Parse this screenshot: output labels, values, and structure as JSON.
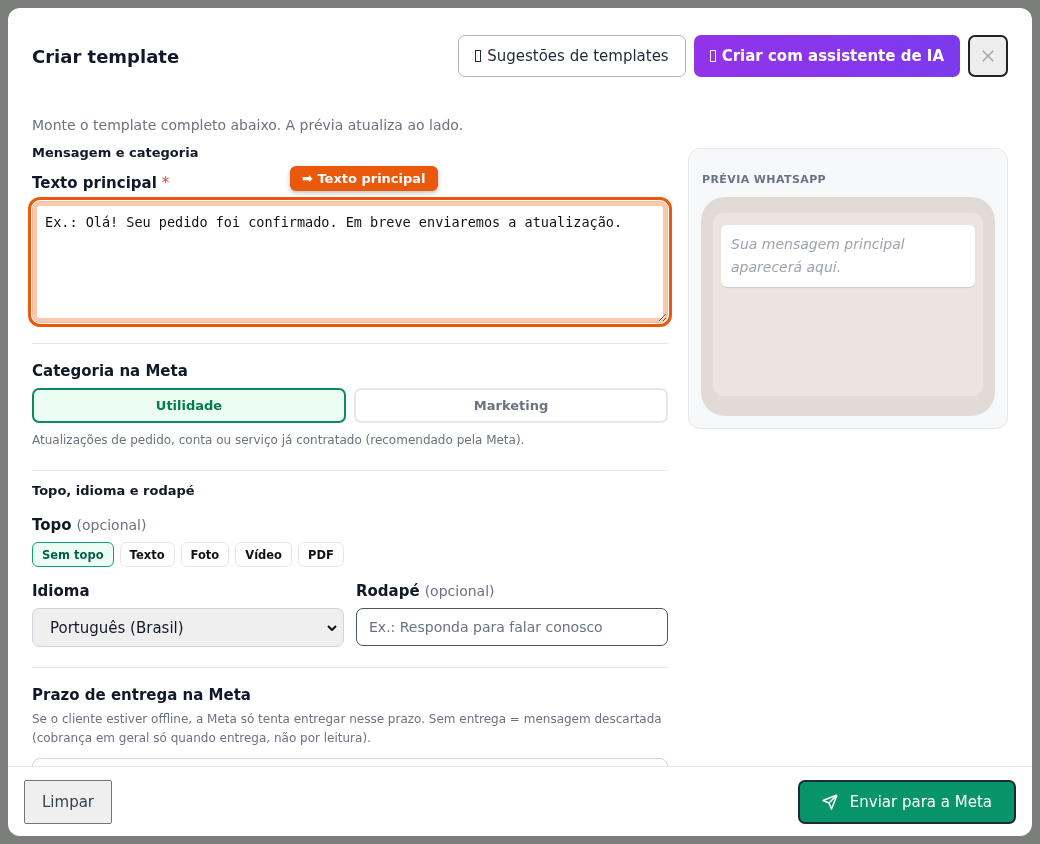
{
  "dialog": {
    "title": "Criar template",
    "actions": [
      {
        "label": "Sugestões de templates",
        "kind": "secondary"
      },
      {
        "label": "Criar com assistente de IA",
        "kind": "primary"
      }
    ]
  },
  "intro": "Monte o template completo abaixo. A prévia atualiza ao lado.",
  "message_section": {
    "heading": "Mensagem e categoria",
    "main_text": {
      "label": "Texto principal",
      "required": "*",
      "placeholder": "Ex.: Olá! Seu pedido foi confirmado. Em breve enviaremos a atualização.",
      "highlighted": true,
      "highlight_badge": "➡ Texto principal"
    },
    "category": {
      "label": "Categoria na Meta",
      "options": [
        {
          "label": "Utilidade",
          "selected": true
        },
        {
          "label": "Marketing",
          "selected": false
        }
      ],
      "hint": "Atualizações de pedido, conta ou serviço já contratado (recomendado pela Meta)."
    }
  },
  "header_section": {
    "heading": "Topo, idioma e rodapé",
    "topo": {
      "label": "Topo",
      "optional": "(opcional)",
      "options": [
        {
          "label": "Sem topo",
          "selected": true
        },
        {
          "label": "Texto",
          "selected": false
        },
        {
          "label": "Foto",
          "selected": false
        },
        {
          "label": "Vídeo",
          "selected": false
        },
        {
          "label": "PDF",
          "selected": false
        }
      ]
    },
    "language": {
      "label": "Idioma",
      "value": "Português (Brasil)"
    },
    "footer": {
      "label": "Rodapé",
      "optional": "(opcional)",
      "placeholder": "Ex.: Responda para falar conosco"
    }
  },
  "delivery_section": {
    "heading": "Prazo de entrega na Meta",
    "description": "Se o cliente estiver offline, a Meta só tenta entregar nesse prazo. Sem entrega = mensagem descartada (cobrança em geral só quando entrega, não por leitura)."
  },
  "preview": {
    "title": "PRÉVIA WHATSAPP",
    "bubble_placeholder": "Sua mensagem principal aparecerá aqui."
  },
  "footer_buttons": [
    {
      "label": "Limpar",
      "kind": "secondary"
    },
    {
      "label": "Enviar para a Meta",
      "kind": "primary"
    }
  ]
}
